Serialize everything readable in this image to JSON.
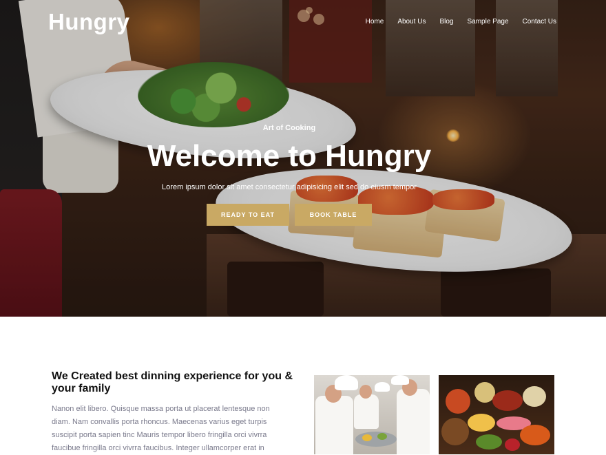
{
  "site": {
    "logo": "Hungry"
  },
  "nav": {
    "items": [
      "Home",
      "About Us",
      "Blog",
      "Sample Page",
      "Contact Us"
    ]
  },
  "hero": {
    "tagline": "Art of Cooking",
    "title": "Welcome to Hungry",
    "subtitle": "Lorem ipsum dolor sit amet consectetur adipisicing elit sed do eiusm tempor",
    "buttons": {
      "primary": "READY TO EAT",
      "secondary": "BOOK TABLE"
    }
  },
  "content": {
    "heading": "We Created best dinning experience for you & your family",
    "paragraph": "Nanon elit libero. Quisque massa porta ut placerat lentesque non diam. Nam convallis porta rhoncus. Maecenas varius eget turpis suscipit porta sapien tinc Mauris tempor libero fringilla orci vivrra faucibue fringilla orci vivrra faucibus. Integer ullamcorper erat in"
  },
  "colors": {
    "accent": "#c9a964",
    "text_muted": "#7a7a8c",
    "heading": "#111111"
  }
}
